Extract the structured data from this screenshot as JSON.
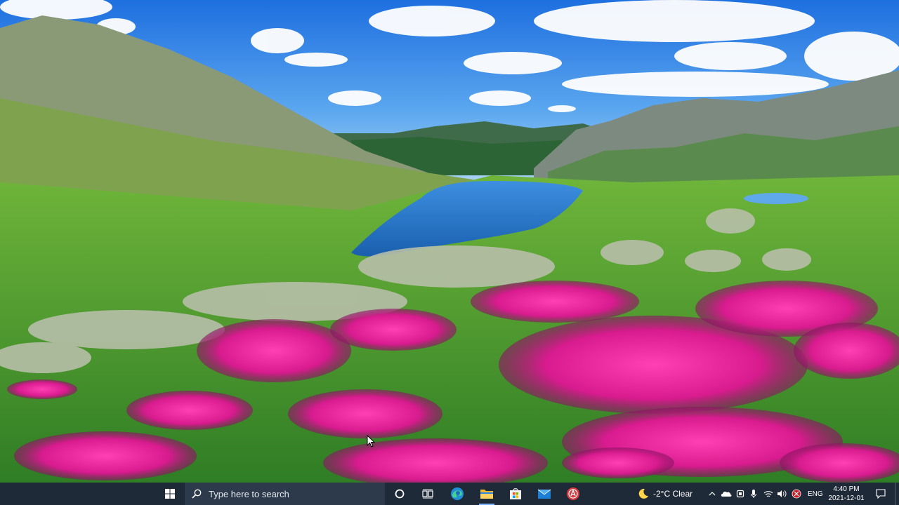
{
  "desktop": {
    "wallpaper": "mountain-lake-flowers-landscape"
  },
  "taskbar": {
    "start_icon": "windows-logo-icon",
    "search": {
      "placeholder": "Type here to search",
      "value": ""
    },
    "pinned": [
      {
        "name": "cortana",
        "icon": "circle-icon"
      },
      {
        "name": "task-view",
        "icon": "task-view-icon"
      },
      {
        "name": "edge",
        "icon": "edge-browser-icon"
      },
      {
        "name": "file-explorer",
        "icon": "folder-icon"
      },
      {
        "name": "microsoft-store",
        "icon": "store-icon"
      },
      {
        "name": "mail",
        "icon": "mail-icon"
      },
      {
        "name": "app",
        "icon": "red-app-icon"
      }
    ],
    "weather": {
      "icon": "moon-icon",
      "text": "-2°C  Clear"
    },
    "tray_icons": [
      "chevron-up-icon",
      "onedrive-cloud-icon",
      "meet-now-icon",
      "microphone-icon",
      "network-icon",
      "volume-icon",
      "security-icon"
    ],
    "language": "ENG",
    "clock": {
      "time": "4:40 PM",
      "date": "2021-12-01"
    },
    "notification_icon": "notification-icon"
  },
  "colors": {
    "taskbar": "#1f2a38",
    "search_box": "#2c3a4b",
    "accent": "#7db3ff"
  }
}
